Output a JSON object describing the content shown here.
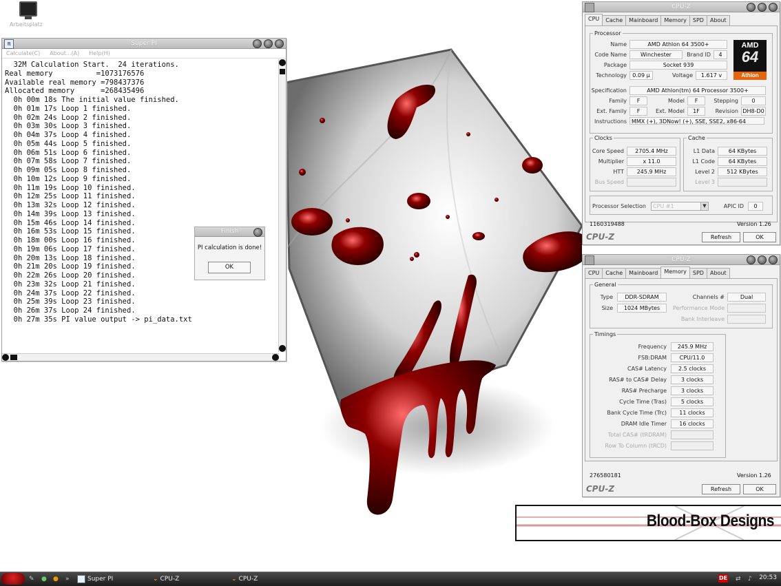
{
  "desktop": {
    "icon_label": "Arbeitsplatz"
  },
  "superpi": {
    "title": "Super PI",
    "menu": [
      "Calculate(C)",
      "About...(A)",
      "Help(H)"
    ],
    "log": [
      "  32M Calculation Start.  24 iterations.",
      "Real memory          =1073176576",
      "Available real memory =798437376",
      "Allocated memory      =268435496",
      "  0h 00m 18s The initial value finished.",
      "  0h 01m 17s Loop 1 finished.",
      "  0h 02m 24s Loop 2 finished.",
      "  0h 03m 30s Loop 3 finished.",
      "  0h 04m 37s Loop 4 finished.",
      "  0h 05m 44s Loop 5 finished.",
      "  0h 06m 51s Loop 6 finished.",
      "  0h 07m 58s Loop 7 finished.",
      "  0h 09m 05s Loop 8 finished.",
      "  0h 10m 12s Loop 9 finished.",
      "  0h 11m 19s Loop 10 finished.",
      "  0h 12m 25s Loop 11 finished.",
      "  0h 13m 32s Loop 12 finished.",
      "  0h 14m 39s Loop 13 finished.",
      "  0h 15m 46s Loop 14 finished.",
      "  0h 16m 53s Loop 15 finished.",
      "  0h 18m 00s Loop 16 finished.",
      "  0h 19m 06s Loop 17 finished.",
      "  0h 20m 13s Loop 18 finished.",
      "  0h 21m 20s Loop 19 finished.",
      "  0h 22m 26s Loop 20 finished.",
      "  0h 23m 32s Loop 21 finished.",
      "  0h 24m 37s Loop 22 finished.",
      "  0h 25m 39s Loop 23 finished.",
      "  0h 26m 37s Loop 24 finished.",
      "  0h 27m 35s PI value output -> pi_data.txt"
    ]
  },
  "finish_dialog": {
    "title": "Finish",
    "message": "PI calculation is done!",
    "ok_label": "OK"
  },
  "cpuz_cpu": {
    "title": "CPU-Z",
    "tabs": [
      "CPU",
      "Cache",
      "Mainboard",
      "Memory",
      "SPD",
      "About"
    ],
    "active_tab": "CPU",
    "processor": {
      "legend": "Processor",
      "name_label": "Name",
      "name": "AMD Athlon 64 3500+",
      "codename_label": "Code Name",
      "codename": "Winchester",
      "brandid_label": "Brand ID",
      "brandid": "4",
      "package_label": "Package",
      "package": "Socket 939",
      "technology_label": "Technology",
      "technology": "0.09 µ",
      "voltage_label": "Voltage",
      "voltage": "1.617 v",
      "spec_label": "Specification",
      "spec": "AMD Athlon(tm) 64 Processor 3500+",
      "family_label": "Family",
      "family": "F",
      "model_label": "Model",
      "model": "F",
      "stepping_label": "Stepping",
      "stepping": "0",
      "extfamily_label": "Ext. Family",
      "extfamily": "F",
      "extmodel_label": "Ext. Model",
      "extmodel": "1F",
      "revision_label": "Revision",
      "revision": "DH8-D0",
      "instructions_label": "Instructions",
      "instructions": "MMX (+), 3DNow! (+), SSE, SSE2, x86-64"
    },
    "logo": {
      "brand": "AMD",
      "number": "64",
      "line": "Athlon"
    },
    "clocks": {
      "legend": "Clocks",
      "core_speed_label": "Core Speed",
      "core_speed": "2705.4 MHz",
      "multiplier_label": "Multiplier",
      "multiplier": "x 11.0",
      "htt_label": "HTT",
      "htt": "245.9 MHz",
      "bus_speed_label": "Bus Speed"
    },
    "cache": {
      "legend": "Cache",
      "l1data_label": "L1 Data",
      "l1data": "64 KBytes",
      "l1code_label": "L1 Code",
      "l1code": "64 KBytes",
      "level2_label": "Level 2",
      "level2": "512 KBytes",
      "level3_label": "Level 3"
    },
    "selection": {
      "label": "Processor Selection",
      "value": "CPU #1",
      "apic_label": "APIC ID",
      "apic": "0"
    },
    "footer": {
      "id": "1160319488",
      "version": "Version 1.26",
      "brand": "CPU-Z",
      "refresh_label": "Refresh",
      "ok_label": "OK"
    }
  },
  "cpuz_mem": {
    "title": "CPU-Z",
    "tabs": [
      "CPU",
      "Cache",
      "Mainboard",
      "Memory",
      "SPD",
      "About"
    ],
    "active_tab": "Memory",
    "general": {
      "legend": "General",
      "type_label": "Type",
      "type": "DDR-SDRAM",
      "size_label": "Size",
      "size": "1024 MBytes",
      "channels_label": "Channels #",
      "channels": "Dual",
      "perf_label": "Performance Mode",
      "interleave_label": "Bank Interleave"
    },
    "timings": {
      "legend": "Timings",
      "rows": [
        {
          "label": "Frequency",
          "value": "245.9 MHz"
        },
        {
          "label": "FSB:DRAM",
          "value": "CPU/11.0"
        },
        {
          "label": "CAS# Latency",
          "value": "2.5 clocks"
        },
        {
          "label": "RAS# to CAS# Delay",
          "value": "3 clocks"
        },
        {
          "label": "RAS# Precharge",
          "value": "3 clocks"
        },
        {
          "label": "Cycle Time (Tras)",
          "value": "5 clocks"
        },
        {
          "label": "Bank Cycle Time (Trc)",
          "value": "11 clocks"
        },
        {
          "label": "DRAM Idle Timer",
          "value": "16 clocks"
        },
        {
          "label": "Total CAS# (tRDRAM)",
          "value": ""
        },
        {
          "label": "Row To Column (tRCD)",
          "value": ""
        }
      ]
    },
    "footer": {
      "id": "276580181",
      "version": "Version 1.26",
      "brand": "CPU-Z",
      "refresh_label": "Refresh",
      "ok_label": "OK"
    }
  },
  "banner": {
    "text": "Blood-Box Designs"
  },
  "taskbar": {
    "items": [
      "Super PI",
      "CPU-Z",
      "CPU-Z"
    ],
    "lang": "DE",
    "clock": "20:53"
  },
  "colors": {
    "blood": "#7a0000",
    "amd_orange": "#e5640c"
  }
}
